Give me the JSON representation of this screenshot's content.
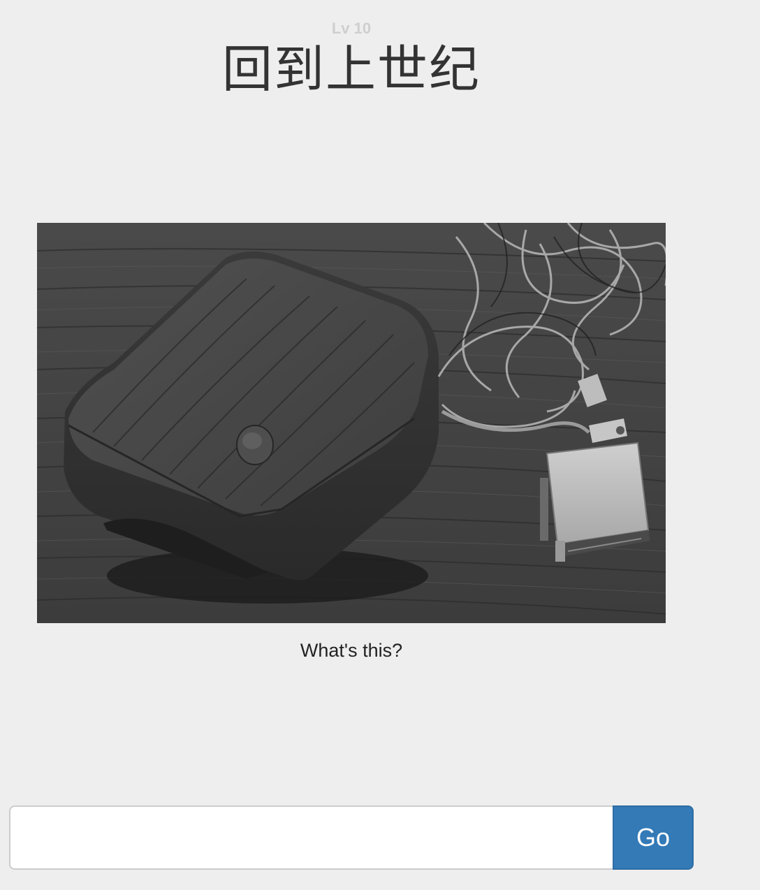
{
  "header": {
    "level": "Lv 10",
    "title": "回到上世纪"
  },
  "puzzle": {
    "question": "What's this?"
  },
  "answer": {
    "value": "",
    "placeholder": "",
    "submit_label": "Go"
  },
  "colors": {
    "background": "#eeeeee",
    "button": "#337ab7"
  }
}
